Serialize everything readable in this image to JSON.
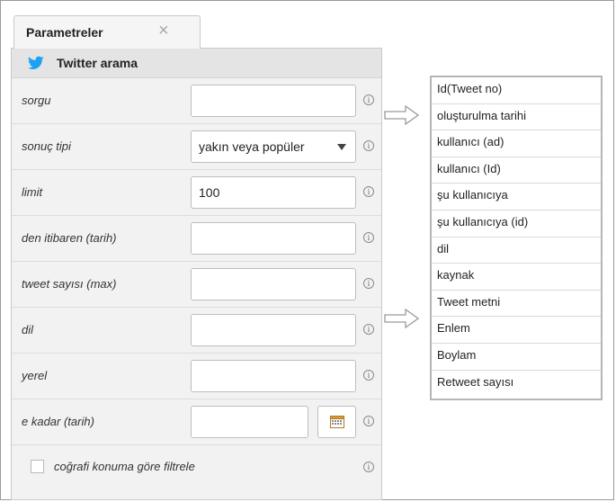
{
  "tab": {
    "title": "Parametreler",
    "close_glyph": "×"
  },
  "section": {
    "title": "Twitter arama",
    "icon": "twitter-bird-icon",
    "icon_color": "#1da1f2"
  },
  "fields": [
    {
      "label": "sorgu",
      "value": ""
    },
    {
      "label": "sonuç tipi",
      "value": "yakın veya popüler"
    },
    {
      "label": "limit",
      "value": "100"
    },
    {
      "label": "den itibaren (tarih)",
      "value": ""
    },
    {
      "label": "tweet sayısı (max)",
      "value": ""
    },
    {
      "label": "dil",
      "value": ""
    },
    {
      "label": "yerel",
      "value": ""
    },
    {
      "label": "e kadar (tarih)",
      "value": ""
    }
  ],
  "geo_filter": {
    "label": "coğrafi konuma göre filtrele",
    "checked": false
  },
  "info_glyph": "i",
  "output_fields": [
    "Id(Tweet no)",
    "oluşturulma tarihi",
    "kullanıcı (ad)",
    "kullanıcı (Id)",
    "şu kullanıcıya",
    "şu kullanıcıya (id)",
    "dil",
    "kaynak",
    "Tweet metni",
    "Enlem",
    "Boylam",
    "Retweet sayısı"
  ]
}
